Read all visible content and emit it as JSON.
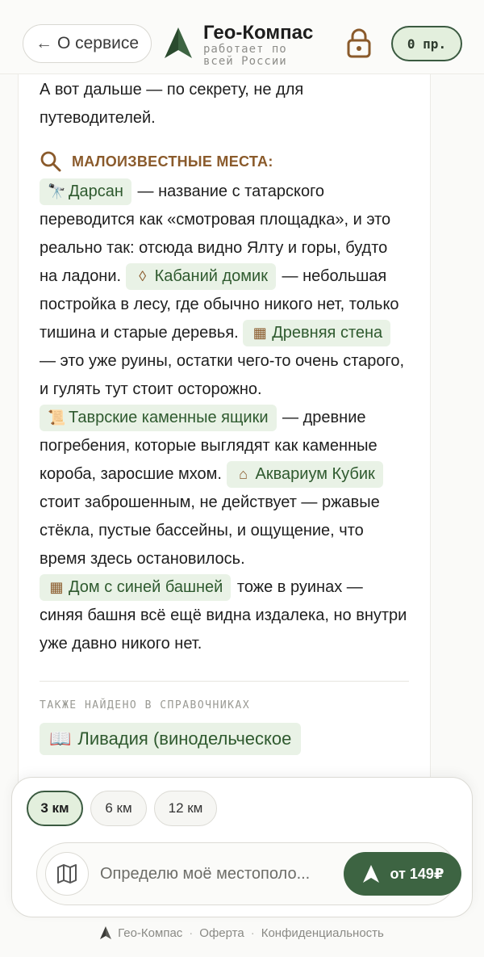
{
  "header": {
    "back_label": "О сервисе",
    "back_arrow": "←",
    "brand_title": "Гео-Компас",
    "brand_subtitle_line1": "работает по",
    "brand_subtitle_line2": "всей России",
    "credits_label": "0 пр.",
    "icons": [
      "compass-arrow-logo",
      "lock-icon"
    ]
  },
  "content": {
    "intro": "А вот дальше — по секрету, не для путеводителей.",
    "section_title": "МАЛОИЗВЕСТНЫЕ МЕСТА:",
    "places": [
      {
        "name": "Дарсан",
        "icon": "telescope-icon",
        "text": " — название с татарского переводится как «смотровая площадка», и это реально так: отсюда видно Ялту и горы, будто на ладони. "
      },
      {
        "name": "Кабаний домик",
        "icon": "drop-icon",
        "text": " — небольшая постройка в лесу, где обычно никого нет, только тишина и старые деревья. "
      },
      {
        "name": "Древняя стена",
        "icon": "brick-wall-icon",
        "text": " — это уже руины, остатки чего-то очень старого, и гулять тут стоит осторожно. "
      },
      {
        "name": "Таврские каменные ящики",
        "icon": "scroll-icon",
        "text": " — древние погребения, которые выглядят как каменные короба, заросшие мхом. "
      },
      {
        "name": "Аквариум Кубик",
        "icon": "home-icon",
        "text": " стоит заброшенным, не действует — ржавые стёкла, пустые бассейны, и ощущение, что время здесь остановилось. "
      },
      {
        "name": "Дом с синей башней",
        "icon": "brick-wall-icon",
        "text": " тоже в руинах — синяя башня всё ещё видна издалека, но внутри уже давно никого нет."
      }
    ],
    "also_title": "ТАКЖЕ НАЙДЕНО В СПРАВОЧНИКАХ",
    "also_item": "Ливадия (винодельческое"
  },
  "panel": {
    "radius_options": [
      "3 км",
      "6 км",
      "12 км"
    ],
    "radius_selected": "3 км",
    "location_placeholder": "Определю моё местополо...",
    "go_label": "от 149₽"
  },
  "footer": {
    "brand": "Гео-Компас",
    "offer": "Оферта",
    "privacy": "Конфиденциальность",
    "separator": "·"
  },
  "colors": {
    "accent_green": "#3d6442",
    "chip_bg": "#e9f2e6",
    "section_brown": "#8a5a2b"
  }
}
